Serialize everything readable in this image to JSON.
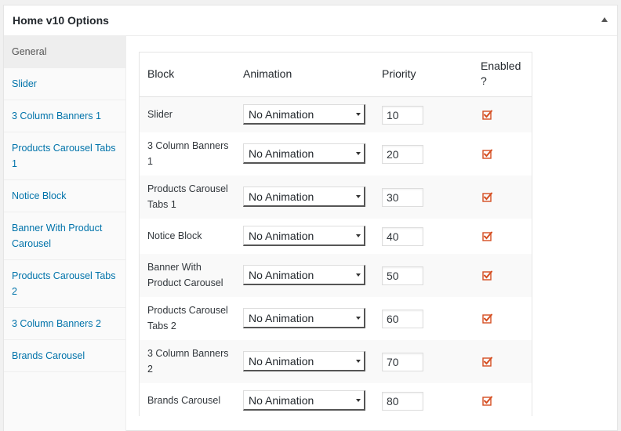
{
  "panel": {
    "title": "Home v10 Options"
  },
  "sidebar": {
    "items": [
      {
        "label": "General"
      },
      {
        "label": "Slider"
      },
      {
        "label": "3 Column Banners 1"
      },
      {
        "label": "Products Carousel Tabs 1"
      },
      {
        "label": "Notice Block"
      },
      {
        "label": "Banner With Product Carousel"
      },
      {
        "label": "Products Carousel Tabs 2"
      },
      {
        "label": "3 Column Banners 2"
      },
      {
        "label": "Brands Carousel"
      }
    ]
  },
  "table": {
    "headers": {
      "block": "Block",
      "animation": "Animation",
      "priority": "Priority",
      "enabled": "Enabled ?"
    },
    "rows": [
      {
        "block": "Slider",
        "animation": "No Animation",
        "priority": "10",
        "enabled": true
      },
      {
        "block": "3 Column Banners 1",
        "animation": "No Animation",
        "priority": "20",
        "enabled": true
      },
      {
        "block": "Products Carousel Tabs 1",
        "animation": "No Animation",
        "priority": "30",
        "enabled": true
      },
      {
        "block": "Notice Block",
        "animation": "No Animation",
        "priority": "40",
        "enabled": true
      },
      {
        "block": "Banner With Product Carousel",
        "animation": "No Animation",
        "priority": "50",
        "enabled": true
      },
      {
        "block": "Products Carousel Tabs 2",
        "animation": "No Animation",
        "priority": "60",
        "enabled": true
      },
      {
        "block": "3 Column Banners 2",
        "animation": "No Animation",
        "priority": "70",
        "enabled": true
      },
      {
        "block": "Brands Carousel",
        "animation": "No Animation",
        "priority": "80",
        "enabled": true
      }
    ]
  },
  "colors": {
    "link": "#0073aa",
    "check": "#d54e21"
  },
  "icons": {
    "toggle": "arrow-up-icon",
    "check": "checked-checkbox-icon",
    "dropdown": "chevron-down-icon"
  }
}
